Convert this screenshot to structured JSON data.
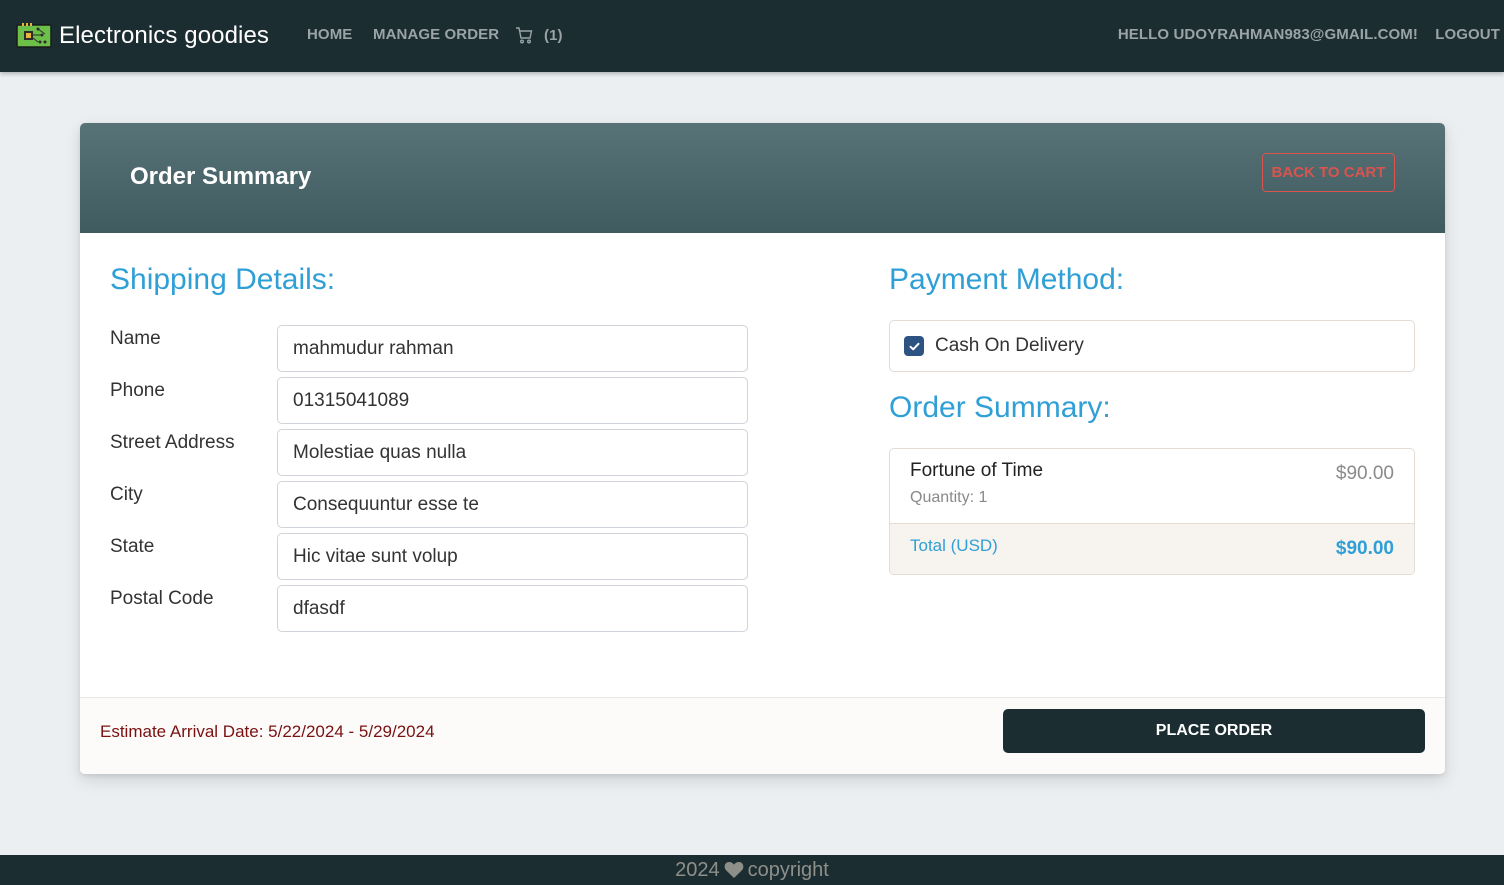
{
  "navbar": {
    "brand": "Electronics goodies",
    "brand_logo": "circuit-board-icon",
    "links": {
      "home": "Home",
      "manage_order": "Manage Order",
      "cart_count": "(1)",
      "cart_icon": "shopping-cart-icon",
      "greeting": "Hello udoyrahman983@gmail.com!",
      "logout": "Logout"
    }
  },
  "card": {
    "title": "Order Summary",
    "back_button": "Back to Cart",
    "shipping": {
      "title": "Shipping Details:",
      "fields": [
        {
          "label": "Name",
          "value": "mahmudur rahman"
        },
        {
          "label": "Phone",
          "value": "01315041089"
        },
        {
          "label": "Street Address",
          "value": "Molestiae quas nulla"
        },
        {
          "label": "City",
          "value": "Consequuntur esse te"
        },
        {
          "label": "State",
          "value": "Hic vitae sunt volup"
        },
        {
          "label": "Postal Code",
          "value": "dfasdf"
        }
      ]
    },
    "payment": {
      "title": "Payment Method:",
      "option": "Cash On Delivery",
      "checked": true
    },
    "order_summary": {
      "title": "Order Summary:",
      "items": [
        {
          "name": "Fortune of Time",
          "quantity": "Quantity: 1",
          "price": "$90.00"
        }
      ],
      "total_label": "Total (USD)",
      "total_value": "$90.00"
    },
    "footer": {
      "arrival": "Estimate Arrival Date: 5/22/2024 - 5/29/2024",
      "place_order": "Place Order"
    }
  },
  "page_footer": {
    "year": "2024",
    "heart_icon": "heart-icon",
    "text": "copyright"
  },
  "colors": {
    "navbar_bg": "#1b2d31",
    "accent_blue": "#2f9fd6",
    "danger": "#d9534f",
    "arrival_text": "#7a1111"
  }
}
